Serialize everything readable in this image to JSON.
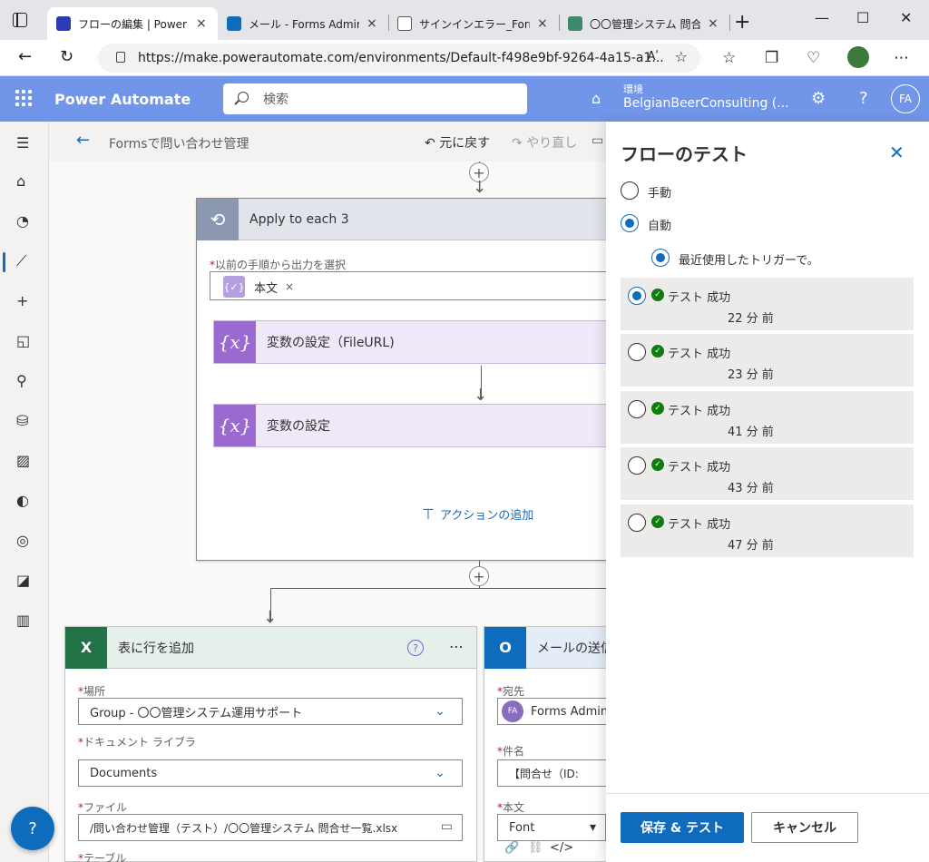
{
  "browser": {
    "tabs": [
      {
        "title": "フローの編集 | Power Au",
        "active": true,
        "icon": "power-automate-icon",
        "color": "#2b3ab7"
      },
      {
        "title": "メール - Forms Admin -",
        "active": false,
        "icon": "outlook-icon",
        "color": "#0f6cbd"
      },
      {
        "title": "サインインエラー_Forms /",
        "active": false,
        "icon": "document-icon",
        "color": "#555555"
      },
      {
        "title": "〇〇管理システム 問合",
        "active": false,
        "icon": "teams-icon",
        "color": "#3c8c6c"
      }
    ],
    "close_glyph": "×",
    "new_tab": "+",
    "url": "https://make.powerautomate.com/environments/Default-f498e9bf-9264-4a15-a1...",
    "read_aloud": "Aʹ",
    "window_controls": [
      "—",
      "☐",
      "✕"
    ]
  },
  "header": {
    "app_name": "Power Automate",
    "search_placeholder": "検索",
    "env_label": "環境",
    "env_name": "BelgianBeerConsulting (...",
    "avatar_initials": "FA"
  },
  "cmdbar": {
    "flow_name": "Formsで問い合わせ管理",
    "undo": "元に戻す",
    "redo": "やり直し"
  },
  "canvas": {
    "apply_each": {
      "title": "Apply to each 3",
      "field_label": "以前の手順から出力を選択",
      "token": "本文",
      "actions": [
        {
          "title": "変数の設定（FileURL)"
        },
        {
          "title": "変数の設定"
        }
      ],
      "add_action": "アクションの追加"
    },
    "excel_card": {
      "title": "表に行を追加",
      "fields": [
        {
          "label": "場所",
          "value": "Group - 〇〇管理システム運用サポート"
        },
        {
          "label": "ドキュメント ライブラリ",
          "value": "Documents"
        },
        {
          "label": "ファイル",
          "value": "/問い合わせ管理（テスト）/〇〇管理システム 問合せ一覧.xlsx"
        },
        {
          "label": "テーブル",
          "value": ""
        }
      ]
    },
    "mail_card": {
      "title": "メールの送信",
      "fields": [
        {
          "label": "宛先",
          "value": "Forms Admin"
        },
        {
          "label": "件名",
          "value": "【問合せ（ID:"
        },
        {
          "label": "本文",
          "value": "Font"
        }
      ]
    }
  },
  "panel": {
    "title": "フローのテスト",
    "options": {
      "manual": "手動",
      "auto": "自動",
      "recent": "最近使用したトリガーで。"
    },
    "runs": [
      {
        "status": "テスト 成功",
        "time": "22 分 前",
        "selected": true
      },
      {
        "status": "テスト 成功",
        "time": "23 分 前",
        "selected": false
      },
      {
        "status": "テスト 成功",
        "time": "41 分 前",
        "selected": false
      },
      {
        "status": "テスト 成功",
        "time": "43 分 前",
        "selected": false
      },
      {
        "status": "テスト 成功",
        "time": "47 分 前",
        "selected": false
      }
    ],
    "save_test": "保存 & テスト",
    "cancel": "キャンセル"
  },
  "colors": {
    "header_bg": "#7195e8",
    "primary": "#0f6cbd",
    "success": "#107c10",
    "variable": "#9a6ad0",
    "excel": "#217346",
    "outlook": "#0f6cbd"
  }
}
